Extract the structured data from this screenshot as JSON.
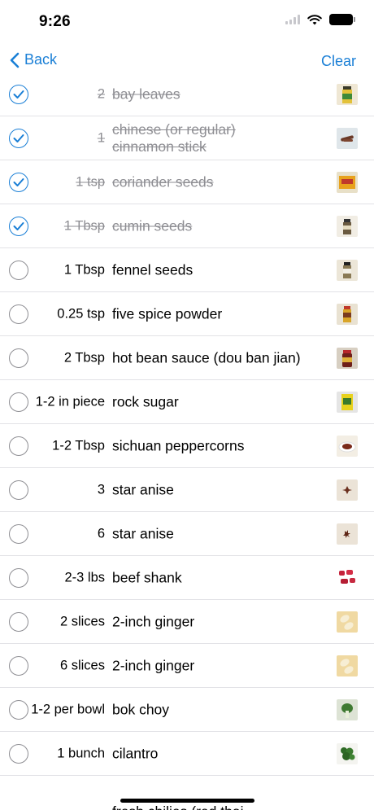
{
  "status": {
    "time": "9:26"
  },
  "nav": {
    "back_label": "Back",
    "clear_label": "Clear"
  },
  "items": [
    {
      "qty": "2",
      "name": "bay leaves",
      "checked": true
    },
    {
      "qty": "1",
      "name": "chinese (or regular)",
      "name2": "cinnamon stick",
      "checked": true
    },
    {
      "qty": "1 tsp",
      "name": "coriander seeds",
      "checked": true
    },
    {
      "qty": "1 Tbsp",
      "name": "cumin seeds",
      "checked": true
    },
    {
      "qty": "1 Tbsp",
      "name": "fennel seeds",
      "checked": false
    },
    {
      "qty": "0.25 tsp",
      "name": "five spice powder",
      "checked": false
    },
    {
      "qty": "2 Tbsp",
      "name": "hot bean sauce (dou ban jian)",
      "checked": false
    },
    {
      "qty": "1-2 in piece",
      "name": "rock sugar",
      "checked": false
    },
    {
      "qty": "1-2 Tbsp",
      "name": "sichuan peppercorns",
      "checked": false
    },
    {
      "qty": "3",
      "name": "star anise",
      "checked": false
    },
    {
      "qty": "6",
      "name": "star anise",
      "checked": false
    },
    {
      "qty": "2-3 lbs",
      "name": "beef shank",
      "checked": false
    },
    {
      "qty": "2 slices",
      "name": "2-inch ginger",
      "checked": false
    },
    {
      "qty": "6 slices",
      "name": "2-inch ginger",
      "checked": false
    },
    {
      "qty": "1-2 per bowl",
      "name": "bok choy",
      "checked": false
    },
    {
      "qty": "1 bunch",
      "name": "cilantro",
      "checked": false
    }
  ],
  "partial_item": {
    "name": "fresh chilies (red thai"
  },
  "colors": {
    "accent": "#1a7fd6",
    "checked_text": "#8e8e93",
    "separator": "#e2e2e6"
  }
}
